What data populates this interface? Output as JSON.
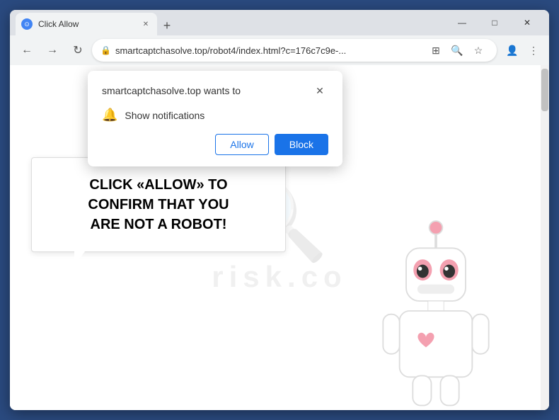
{
  "browser": {
    "tab": {
      "title": "Click Allow",
      "favicon_label": "⊙"
    },
    "new_tab_btn": "+",
    "nav": {
      "back_label": "←",
      "forward_label": "→",
      "reload_label": "↻"
    },
    "address": {
      "lock_icon": "🔒",
      "url": "smartcaptchasolve.top/robot4/index.html?c=176c7c9e-..."
    },
    "actions": {
      "translate_icon": "⊞",
      "search_icon": "🔍",
      "bookmark_icon": "☆",
      "profile_icon": "👤",
      "menu_icon": "⋮"
    }
  },
  "window_controls": {
    "minimize": "—",
    "maximize": "□",
    "close": "✕"
  },
  "notification_popup": {
    "site_text": "smartcaptchasolve.top wants to",
    "close_label": "✕",
    "notification_text": "Show notifications",
    "allow_label": "Allow",
    "block_label": "Block"
  },
  "page": {
    "main_text_line1": "CLICK «ALLOW» TO CONFIRM THAT YOU",
    "main_text_line2": "ARE NOT A ROBOT!",
    "watermark_top": "⌕",
    "watermark_bottom": "risk.co"
  }
}
